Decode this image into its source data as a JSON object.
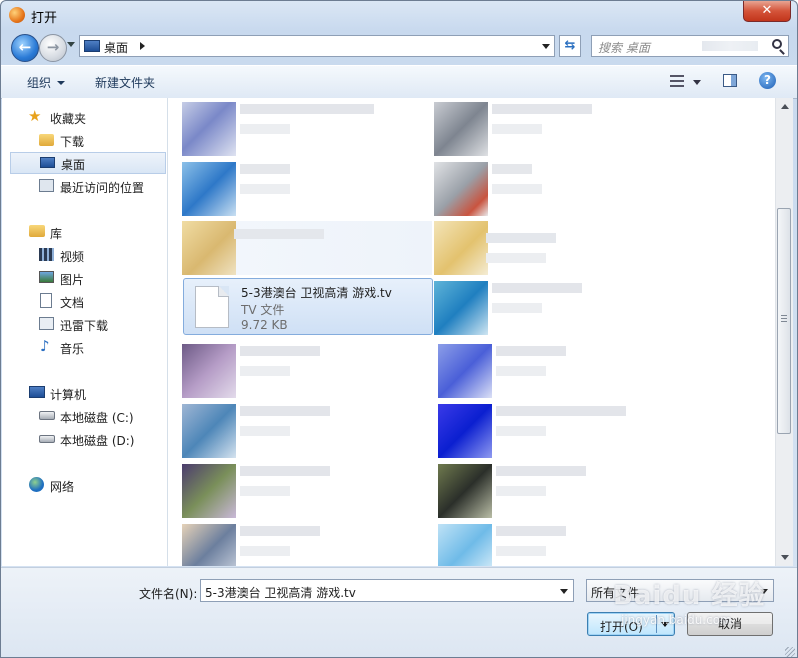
{
  "window": {
    "title": "打开",
    "close_glyph": "✕"
  },
  "nav": {
    "back_glyph": "←",
    "forward_glyph": "→",
    "address": "桌面",
    "refresh_glyph": "⇆",
    "search_placeholder": "搜索 桌面"
  },
  "toolbar": {
    "organize": "组织",
    "new_folder": "新建文件夹",
    "help_glyph": "?"
  },
  "sidebar": {
    "items": [
      {
        "label": "收藏夹",
        "icon": "star-icon"
      },
      {
        "label": "下载",
        "icon": "download-folder-icon"
      },
      {
        "label": "桌面",
        "icon": "desktop-icon",
        "selected": true
      },
      {
        "label": "最近访问的位置",
        "icon": "recent-places-icon"
      },
      {
        "label": "库",
        "icon": "library-icon"
      },
      {
        "label": "视频",
        "icon": "video-icon"
      },
      {
        "label": "图片",
        "icon": "pictures-icon"
      },
      {
        "label": "文档",
        "icon": "documents-icon"
      },
      {
        "label": "迅雷下载",
        "icon": "thunder-download-icon"
      },
      {
        "label": "音乐",
        "icon": "music-icon"
      },
      {
        "label": "计算机",
        "icon": "computer-icon"
      },
      {
        "label": "本地磁盘 (C:)",
        "icon": "drive-c-icon"
      },
      {
        "label": "本地磁盘 (D:)",
        "icon": "drive-d-icon"
      },
      {
        "label": "网络",
        "icon": "network-icon"
      }
    ]
  },
  "selected_file": {
    "name": "5-3港澳台 卫视高清 游戏.tv",
    "type": "TV 文件",
    "size": "9.72 KB"
  },
  "colors": {
    "accent": "#3c7fb1",
    "selection": "#cfe0f5",
    "frame": "#c8d9ee"
  },
  "bottom": {
    "filename_label": "文件名(N):",
    "filename_value": "5-3港澳台 卫视高清 游戏.tv",
    "filter": "所有文件",
    "open": "打开(O)",
    "cancel": "取消"
  },
  "watermark": {
    "main": "Baidu 经验",
    "sub": "jingyan.baidu.com"
  }
}
